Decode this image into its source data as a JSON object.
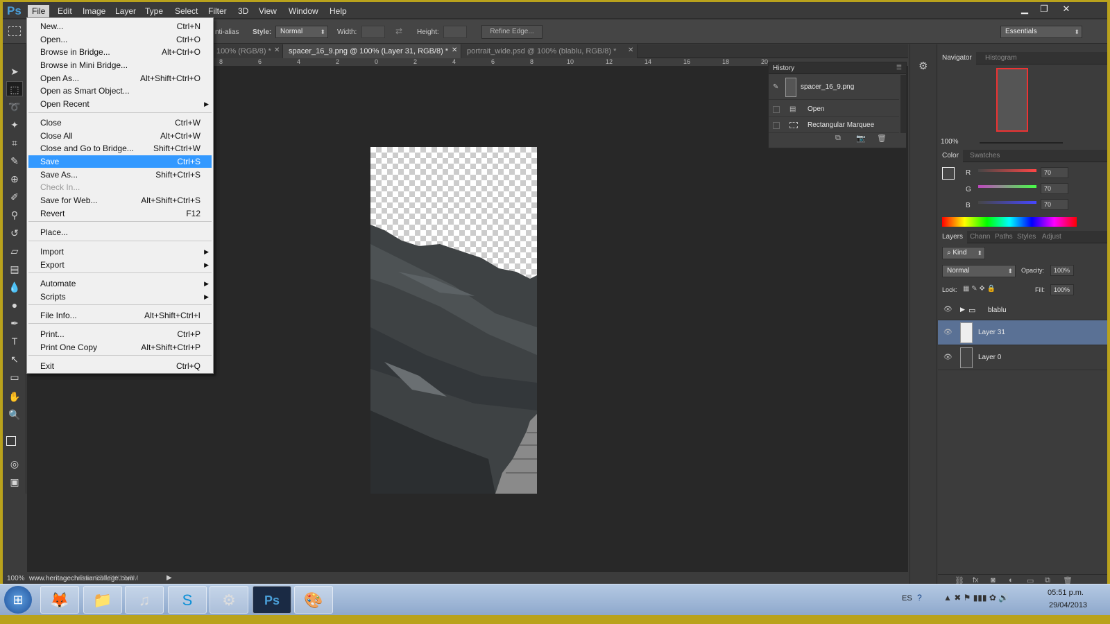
{
  "app": {
    "logo": "Ps"
  },
  "menubar": [
    "File",
    "Edit",
    "Image",
    "Layer",
    "Type",
    "Select",
    "Filter",
    "3D",
    "View",
    "Window",
    "Help"
  ],
  "options": {
    "antialias": "nti-alias",
    "style_label": "Style:",
    "style_value": "Normal",
    "width_label": "Width:",
    "height_label": "Height:",
    "refine": "Refine Edge...",
    "workspace": "Essentials"
  },
  "tabs": [
    {
      "label": "100% (RGB/8) *"
    },
    {
      "label": "spacer_16_9.png @ 100% (Layer 31, RGB/8) *"
    },
    {
      "label": "portrait_wide.psd @ 100% (blablu, RGB/8) *"
    }
  ],
  "ruler": [
    "8",
    "6",
    "4",
    "2",
    "0",
    "2",
    "4",
    "6",
    "8",
    "10",
    "12",
    "14",
    "16",
    "18",
    "20"
  ],
  "file_menu": [
    {
      "label": "New...",
      "shortcut": "Ctrl+N"
    },
    {
      "label": "Open...",
      "shortcut": "Ctrl+O"
    },
    {
      "label": "Browse in Bridge...",
      "shortcut": "Alt+Ctrl+O"
    },
    {
      "label": "Browse in Mini Bridge...",
      "shortcut": ""
    },
    {
      "label": "Open As...",
      "shortcut": "Alt+Shift+Ctrl+O"
    },
    {
      "label": "Open as Smart Object...",
      "shortcut": ""
    },
    {
      "label": "Open Recent",
      "shortcut": ""
    },
    {
      "label": "Close",
      "shortcut": "Ctrl+W"
    },
    {
      "label": "Close All",
      "shortcut": "Alt+Ctrl+W"
    },
    {
      "label": "Close and Go to Bridge...",
      "shortcut": "Shift+Ctrl+W"
    },
    {
      "label": "Save",
      "shortcut": "Ctrl+S"
    },
    {
      "label": "Save As...",
      "shortcut": "Shift+Ctrl+S"
    },
    {
      "label": "Check In...",
      "shortcut": ""
    },
    {
      "label": "Save for Web...",
      "shortcut": "Alt+Shift+Ctrl+S"
    },
    {
      "label": "Revert",
      "shortcut": "F12"
    },
    {
      "label": "Place...",
      "shortcut": ""
    },
    {
      "label": "Import",
      "shortcut": ""
    },
    {
      "label": "Export",
      "shortcut": ""
    },
    {
      "label": "Automate",
      "shortcut": ""
    },
    {
      "label": "Scripts",
      "shortcut": ""
    },
    {
      "label": "File Info...",
      "shortcut": "Alt+Shift+Ctrl+I"
    },
    {
      "label": "Print...",
      "shortcut": "Ctrl+P"
    },
    {
      "label": "Print One Copy",
      "shortcut": "Alt+Shift+Ctrl+P"
    },
    {
      "label": "Exit",
      "shortcut": "Ctrl+Q"
    }
  ],
  "history": {
    "title": "History",
    "snapshot": "spacer_16_9.png",
    "items": [
      "Open",
      "Rectangular Marquee"
    ]
  },
  "navigator": {
    "tabs": [
      "Navigator",
      "Histogram"
    ],
    "zoom": "100%"
  },
  "color": {
    "tabs": [
      "Color",
      "Swatches"
    ],
    "r_label": "R",
    "g_label": "G",
    "b_label": "B",
    "r": "70",
    "g": "70",
    "b": "70"
  },
  "layers": {
    "tabs": [
      "Layers",
      "Chann",
      "Paths",
      "Styles",
      "Adjust"
    ],
    "kind": "Kind",
    "blend": "Normal",
    "opacity_label": "Opacity:",
    "opacity": "100%",
    "lock_label": "Lock:",
    "fill_label": "Fill:",
    "fill": "100%",
    "items": [
      {
        "name": "blablu"
      },
      {
        "name": "Layer 31"
      },
      {
        "name": "Layer 0"
      }
    ]
  },
  "status": {
    "zoom": "100%",
    "watermark": "www.heritagechristiancollege.com",
    "doc": "Doc: 351,6K/19,6M"
  },
  "taskbar": {
    "lang": "ES",
    "time": "05:51 p.m.",
    "date": "29/04/2013"
  }
}
